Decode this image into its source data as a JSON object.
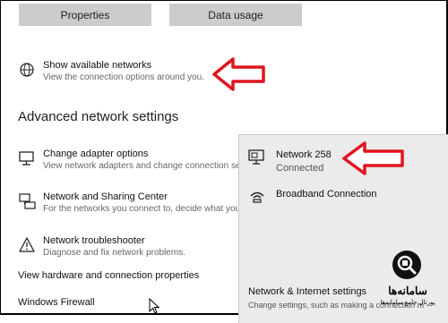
{
  "buttons": {
    "properties": "Properties",
    "data_usage": "Data usage"
  },
  "show_networks": {
    "title": "Show available networks",
    "desc": "View the connection options around you."
  },
  "advanced_heading": "Advanced network settings",
  "items": [
    {
      "title": "Change adapter options",
      "desc": "View network adapters and change connection se"
    },
    {
      "title": "Network and Sharing Center",
      "desc": "For the networks you connect to, decide what you"
    },
    {
      "title": "Network troubleshooter",
      "desc": "Diagnose and fix network problems."
    }
  ],
  "links": {
    "hardware": "View hardware and connection properties",
    "firewall": "Windows Firewall"
  },
  "popup": {
    "network_name": "Network 258",
    "network_status": "Connected",
    "broadband": "Broadband Connection",
    "settings_title": "Network & Internet settings",
    "settings_desc": "Change settings, such as making a connection m"
  },
  "logo": {
    "text1": "سامانه‌ها",
    "text2": "پورتال جامع سامانه‌ها"
  },
  "colors": {
    "arrow": "#e0141e",
    "button_bg": "#cccccc",
    "popup_bg": "#ebebeb"
  },
  "icons": [
    "globe-icon",
    "monitor-icon",
    "network-sharing-icon",
    "warning-icon",
    "ethernet-icon",
    "dialup-icon",
    "cursor-icon"
  ]
}
